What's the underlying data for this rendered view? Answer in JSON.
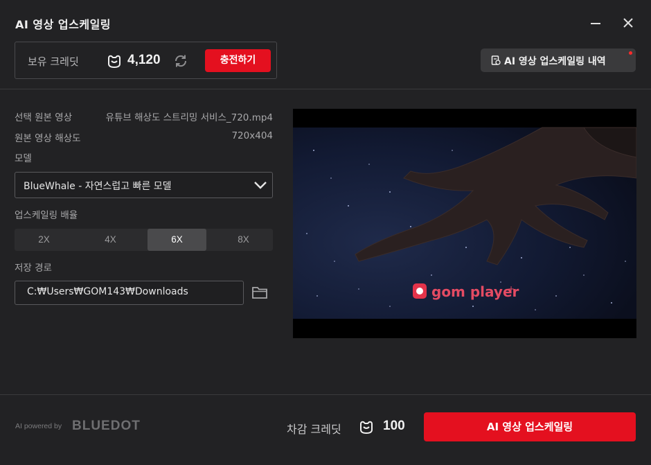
{
  "window": {
    "title": "AI 영상 업스케일링",
    "minimize_icon": "minimize-icon",
    "close_icon": "close-icon"
  },
  "credits": {
    "label": "보유 크레딧",
    "icon": "credit-coin-icon",
    "value": "4,120",
    "refresh_icon": "refresh-icon",
    "charge_button": "충전하기"
  },
  "history_button": {
    "icon": "document-icon",
    "label": "AI 영상 업스케일링 내역",
    "has_notification": true
  },
  "info": {
    "source_label": "선택 원본 영상",
    "source_value": "유튜브 해상도 스트리밍 서비스_720.mp4",
    "resolution_label": "원본 영상 해상도",
    "resolution_value": "720x404"
  },
  "model": {
    "label": "모델",
    "selected": "BlueWhale - 자연스럽고 빠른 모델"
  },
  "scale": {
    "label": "업스케일링 배율",
    "options": [
      "2X",
      "4X",
      "6X",
      "8X"
    ],
    "selected": "6X"
  },
  "save_path": {
    "label": "저장 경로",
    "value": "C:₩Users₩GOM143₩Downloads",
    "folder_icon": "folder-icon"
  },
  "preview": {
    "watermark": "gom player",
    "watermark_plus": "+"
  },
  "footer": {
    "powered_by": "AI powered by",
    "brand": "BLUEDOT",
    "deduct_label": "차감 크레딧",
    "deduct_value": "100",
    "upscale_button": "AI 영상 업스케일링"
  },
  "colors": {
    "background": "#222224",
    "accent": "#e4101f",
    "panel": "#2c2c2e"
  }
}
